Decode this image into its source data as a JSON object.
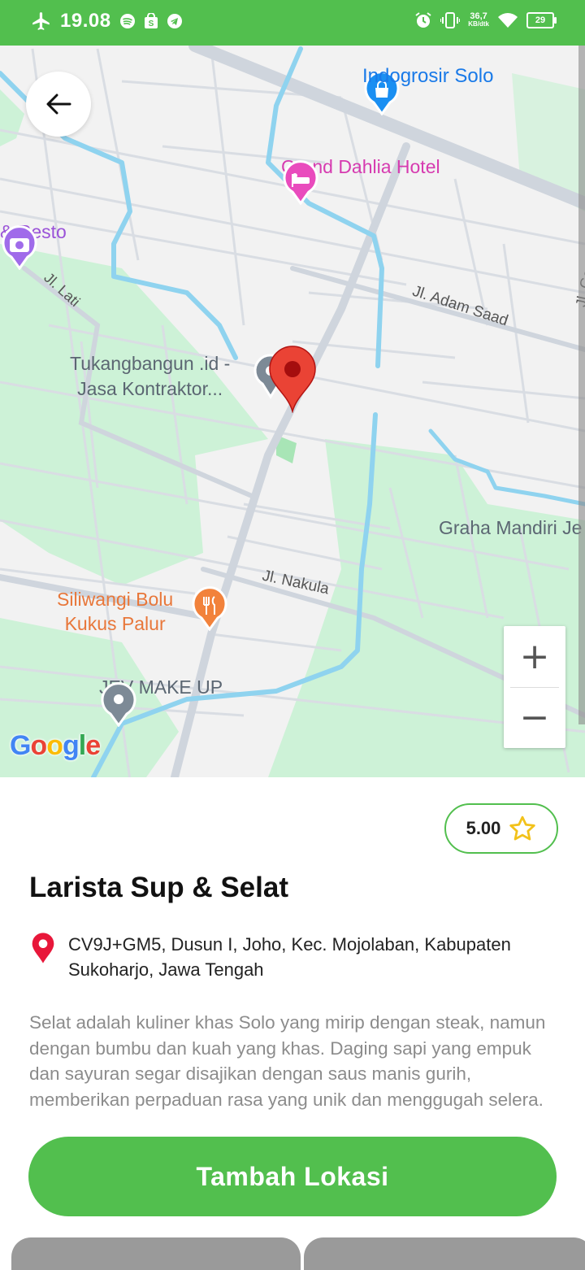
{
  "status_bar": {
    "time": "19.08",
    "net_speed_value": "36,7",
    "net_speed_unit": "KB/dtk",
    "battery": "29"
  },
  "map": {
    "places": {
      "indogrosir": "Indogrosir Solo",
      "grand_dahlia": "Grand Dahlia Hotel",
      "resto": "& Resto",
      "tukangbangun_line1": "Tukangbangun .id -",
      "tukangbangun_line2": "Jasa Kontraktor...",
      "graha_mandiri": "Graha Mandiri Je",
      "siliwangi_line1": "Siliwangi Bolu",
      "siliwangi_line2": "Kukus Palur",
      "jev": "JEV MAKE UP"
    },
    "streets": {
      "lati": "Jl. Lati",
      "adam_saad": "Jl. Adam Saad",
      "nakula": "Jl. Nakula",
      "garuda": "Jl. Garu"
    },
    "zoom_in": "+",
    "zoom_out": "−",
    "attribution": "Google"
  },
  "place": {
    "rating": "5.00",
    "name": "Larista Sup & Selat",
    "address": "CV9J+GM5, Dusun I, Joho, Kec. Mojolaban, Kabupaten Sukoharjo, Jawa Tengah",
    "description": "Selat adalah kuliner khas Solo yang mirip dengan steak, namun dengan bumbu dan kuah yang khas. Daging sapi yang empuk dan sayuran segar disajikan dengan saus manis gurih, memberikan perpaduan rasa yang unik dan menggugah selera."
  },
  "actions": {
    "add_location": "Tambah Lokasi"
  },
  "colors": {
    "brand_green": "#52bf4e",
    "marker_red": "#ea4335",
    "water": "#8fd3ef",
    "park": "#cdf2d7"
  }
}
